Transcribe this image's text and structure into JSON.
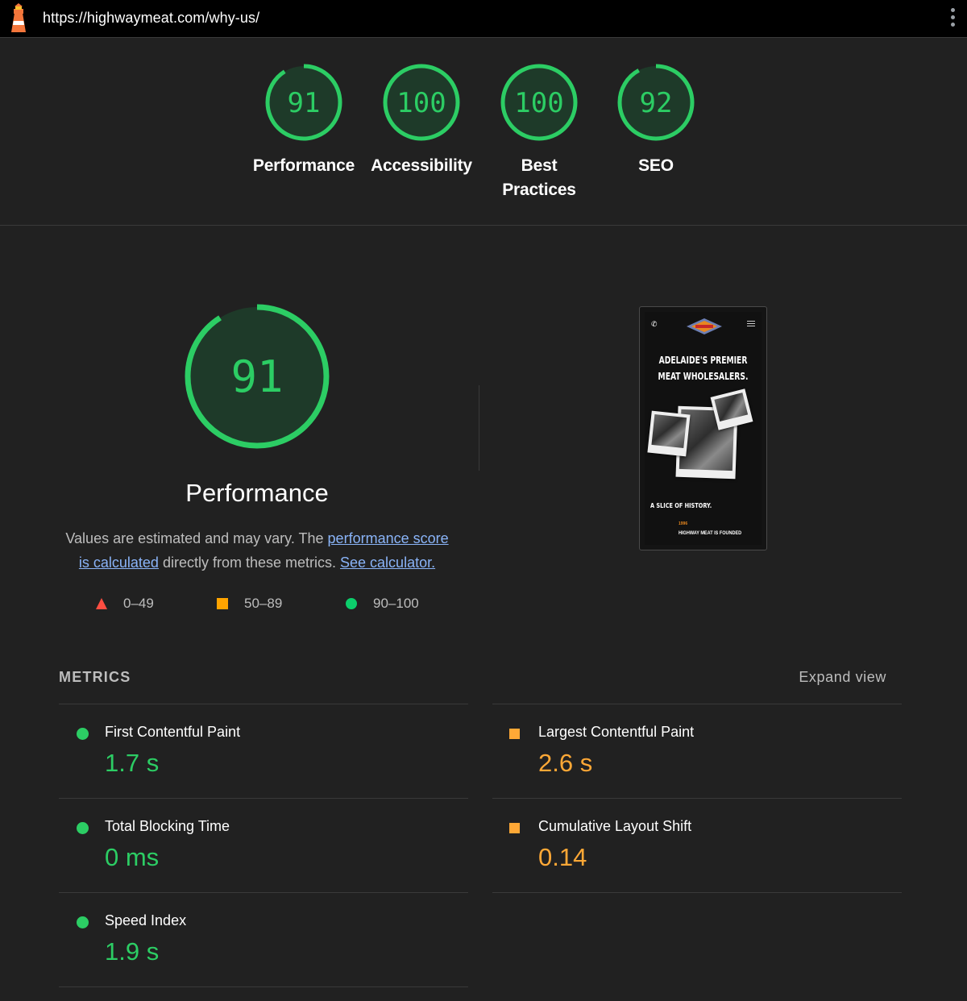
{
  "browser": {
    "url": "https://highwaymeat.com/why-us/"
  },
  "summary": {
    "gauges": [
      {
        "score": "91",
        "label": "Performance"
      },
      {
        "score": "100",
        "label": "Accessibility"
      },
      {
        "score": "100",
        "label_line1": "Best",
        "label_line2": "Practices"
      },
      {
        "score": "92",
        "label": "SEO"
      }
    ]
  },
  "performance": {
    "score": "91",
    "title": "Performance",
    "desc_prefix": "Values are estimated and may vary. The ",
    "link_score": "performance score",
    "link_calc": "is calculated",
    "desc_middle": " directly from these metrics. ",
    "link_calculator": "See calculator.",
    "legend": [
      {
        "range": "0–49",
        "color": "#ff4e42"
      },
      {
        "range": "50–89",
        "color": "#ffa400"
      },
      {
        "range": "90–100",
        "color": "#0cce6b"
      }
    ]
  },
  "thumbnail": {
    "headline_line1": "ADELAIDE'S PREMIER",
    "headline_line2": "MEAT WHOLESALERS.",
    "slice": "A SLICE OF HISTORY.",
    "year": "1996",
    "founded": "HIGHWAY MEAT IS FOUNDED"
  },
  "metrics": {
    "heading": "METRICS",
    "expand_label": "Expand view",
    "left": [
      {
        "name": "First Contentful Paint",
        "value": "1.7 s",
        "status": "good"
      },
      {
        "name": "Total Blocking Time",
        "value": "0 ms",
        "status": "good"
      },
      {
        "name": "Speed Index",
        "value": "1.9 s",
        "status": "good"
      }
    ],
    "right": [
      {
        "name": "Largest Contentful Paint",
        "value": "2.6 s",
        "status": "average"
      },
      {
        "name": "Cumulative Layout Shift",
        "value": "0.14",
        "status": "average"
      }
    ]
  },
  "colors": {
    "good": "#2ccd64",
    "average": "#ffa836",
    "background": "#212121"
  }
}
